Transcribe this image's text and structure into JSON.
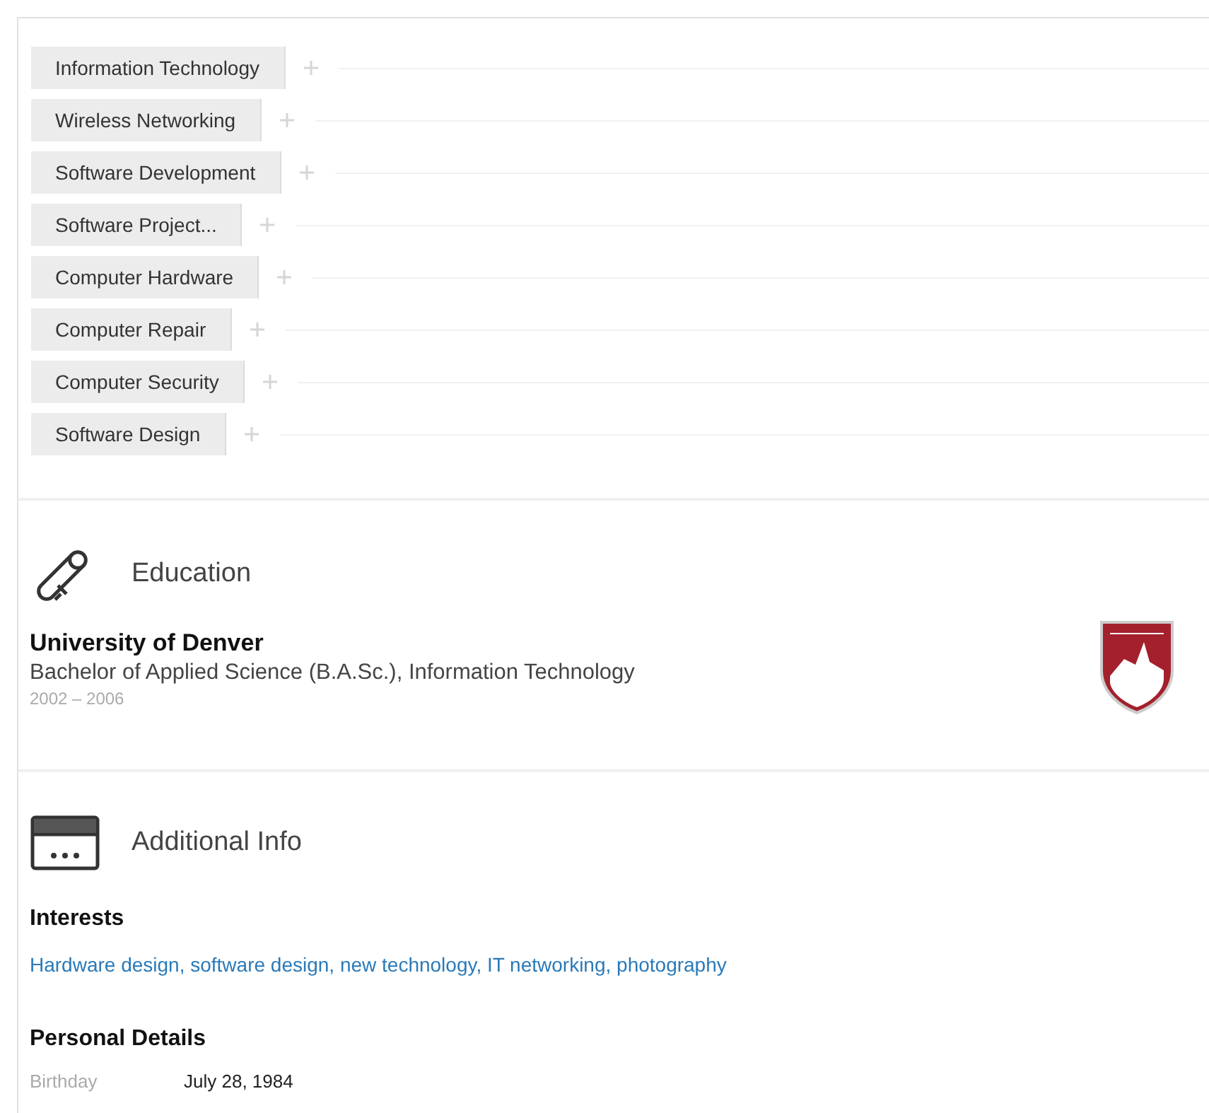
{
  "skills": [
    "Information Technology",
    "Wireless Networking",
    "Software Development",
    "Software Project...",
    "Computer Hardware",
    "Computer Repair",
    "Computer Security",
    "Software Design"
  ],
  "education": {
    "heading": "Education",
    "school": "University of Denver",
    "degree": "Bachelor of Applied Science (B.A.Sc.), Information Technology",
    "years": "2002 – 2006"
  },
  "additional_info": {
    "heading": "Additional Info",
    "interests_title": "Interests",
    "interests": "Hardware design, software design, new technology, IT networking, photography",
    "personal_title": "Personal Details",
    "details": [
      {
        "label": "Birthday",
        "value": "July 28, 1984"
      }
    ]
  }
}
